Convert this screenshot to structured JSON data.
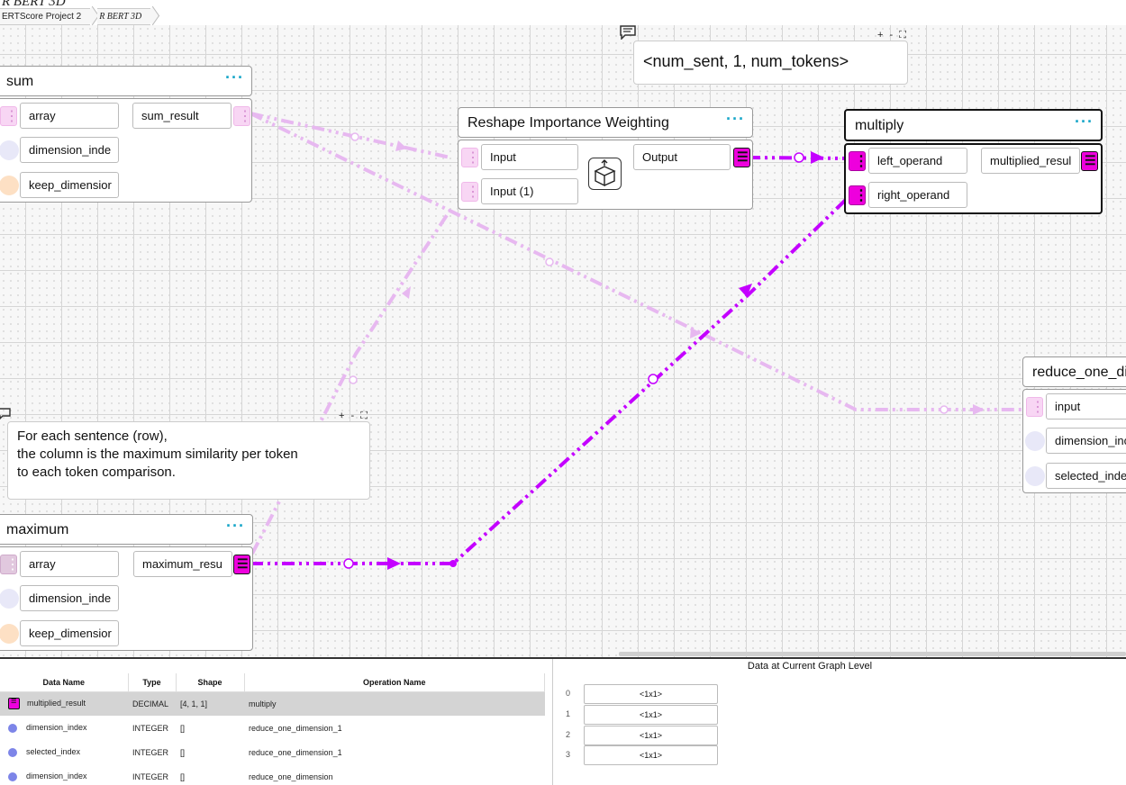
{
  "app": {
    "title": "R BERT 3D"
  },
  "breadcrumb": [
    {
      "label": "ERTScore Project 2"
    },
    {
      "label": "R BERT 3D"
    }
  ],
  "canvas": {
    "comments": [
      {
        "text": "<num_sent, 1, num_tokens>",
        "controls": "+ - ⛶"
      },
      {
        "lines": [
          "For each sentence (row),",
          "the column is the maximum similarity per token",
          "to each token comparison."
        ],
        "controls": "+ - ⛶"
      }
    ],
    "nodes": {
      "sum": {
        "title": "sum",
        "menu": "···",
        "inputs": [
          "array",
          "dimension_inde",
          "keep_dimensior"
        ],
        "output": "sum_result"
      },
      "reshape": {
        "title": "Reshape Importance Weighting",
        "menu": "···",
        "inputs": [
          "Input",
          "Input (1)"
        ],
        "output": "Output"
      },
      "multiply": {
        "title": "multiply",
        "menu": "···",
        "inputs": [
          "left_operand",
          "right_operand"
        ],
        "output": "multiplied_resul"
      },
      "reduce": {
        "title": "reduce_one_di",
        "inputs": [
          "input",
          "dimension_inc",
          "selected_inde"
        ]
      },
      "maximum": {
        "title": "maximum",
        "menu": "···",
        "inputs": [
          "array",
          "dimension_inde",
          "keep_dimensior"
        ],
        "output": "maximum_resu"
      }
    },
    "colors": {
      "edge_active": "#c400ff",
      "edge_faded": "#e7b8f0",
      "port_accent": "#ee00dd",
      "menu_accent": "#1aa7c9"
    }
  },
  "data_table": {
    "columns": [
      "Data Name",
      "Type",
      "Shape",
      "Operation Name"
    ],
    "rows": [
      {
        "name": "multiplied_result",
        "type": "DECIMAL",
        "shape": "[4, 1, 1]",
        "operation": "multiply",
        "icon": "list-icon",
        "selected": true
      },
      {
        "name": "dimension_index",
        "type": "INTEGER",
        "shape": "[]",
        "operation": "reduce_one_dimension_1",
        "icon": "dot-icon"
      },
      {
        "name": "selected_index",
        "type": "INTEGER",
        "shape": "[]",
        "operation": "reduce_one_dimension_1",
        "icon": "dot-icon"
      },
      {
        "name": "dimension_index",
        "type": "INTEGER",
        "shape": "[]",
        "operation": "reduce_one_dimension",
        "icon": "dot-icon"
      }
    ]
  },
  "data_level": {
    "title": "Data at Current Graph Level",
    "items": [
      {
        "index": "0",
        "value": "<1x1>"
      },
      {
        "index": "1",
        "value": "<1x1>"
      },
      {
        "index": "2",
        "value": "<1x1>"
      },
      {
        "index": "3",
        "value": "<1x1>"
      }
    ]
  }
}
